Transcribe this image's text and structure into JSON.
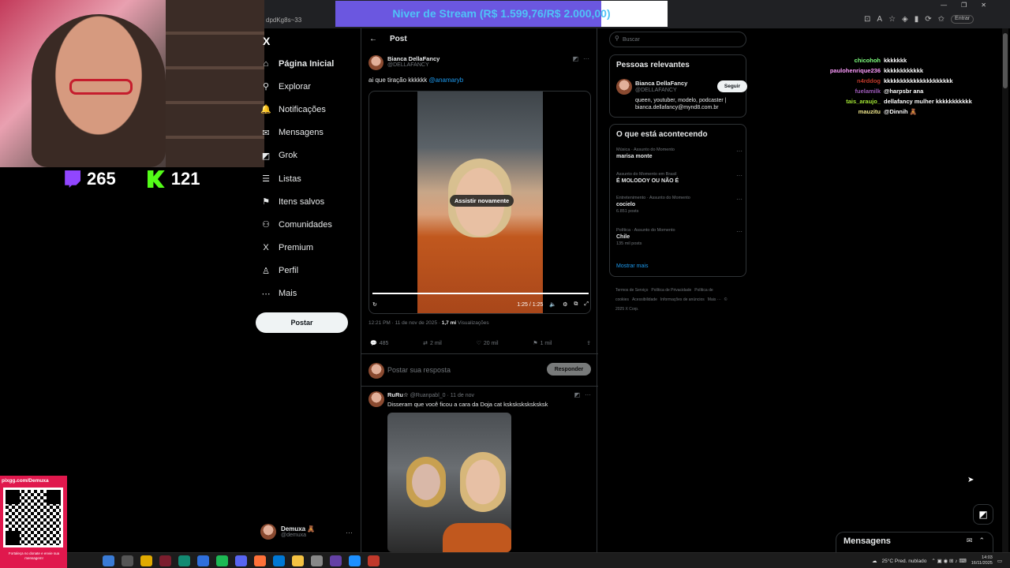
{
  "stream": {
    "goal_text": "Niver de Stream (R$ 1.599,76/R$ 2.000,00)",
    "goal_progress": 0.7999,
    "twitch_viewers": "265",
    "kick_viewers": "121",
    "pix_url": "pixgg.com/Demuxa",
    "pix_note": "Fortaleça no donate e envie sua mensagem!"
  },
  "browser": {
    "url_fragment": "dpdKg8s~33",
    "profile_label": "Entrar"
  },
  "nav": {
    "items": [
      {
        "label": "Página Inicial",
        "icon": "home-icon",
        "glyph": "⌂"
      },
      {
        "label": "Explorar",
        "icon": "search-icon",
        "glyph": "⚲"
      },
      {
        "label": "Notificações",
        "icon": "bell-icon",
        "glyph": "🔔"
      },
      {
        "label": "Mensagens",
        "icon": "mail-icon",
        "glyph": "✉"
      },
      {
        "label": "Grok",
        "icon": "grok-icon",
        "glyph": "◩"
      },
      {
        "label": "Listas",
        "icon": "list-icon",
        "glyph": "☰"
      },
      {
        "label": "Itens salvos",
        "icon": "bookmark-icon",
        "glyph": "⚑"
      },
      {
        "label": "Comunidades",
        "icon": "people-icon",
        "glyph": "⚇"
      },
      {
        "label": "Premium",
        "icon": "x-logo-icon",
        "glyph": "X"
      },
      {
        "label": "Perfil",
        "icon": "person-icon",
        "glyph": "♙"
      },
      {
        "label": "Mais",
        "icon": "more-circle-icon",
        "glyph": "⋯"
      }
    ],
    "post_button": "Postar",
    "account_name": "Demuxa 🧸",
    "account_handle": "@demuxa"
  },
  "post": {
    "header_title": "Post",
    "author_name": "Bianca DellaFancy",
    "author_handle": "@DELLAFANCY",
    "text": "ai que tiração kkkkkk",
    "mention": "@anamaryb",
    "video_overlay": "Assistir novamente",
    "video_time": "1:25 / 1:25",
    "video_progress": 1.0,
    "timestamp": "12:21 PM · 11 de nov de 2025 ·",
    "views_count": "1,7 mi",
    "views_label": "Visualizações",
    "replies": "485",
    "reposts": "2 mil",
    "likes": "20 mil",
    "bookmarks": "1 mil"
  },
  "reply_box": {
    "placeholder": "Postar sua resposta",
    "button": "Responder"
  },
  "reply1": {
    "name": "RuRu☆",
    "handle": "@Ruanpabl_0 · 11 de nov",
    "text": "Disseram que você ficou a cara da Doja cat ksksksksksksksk"
  },
  "search": {
    "placeholder": "Buscar"
  },
  "relevant": {
    "title": "Pessoas relevantes",
    "name": "Bianca DellaFancy",
    "handle": "@DELLAFANCY",
    "bio": "queen, youtuber, modelo, podcaster | bianca.dellafancy@mynd8.com.br",
    "follow": "Seguir"
  },
  "trends": {
    "title": "O que está acontecendo",
    "items": [
      {
        "category": "Música · Assunto do Momento",
        "topic": "marisa monte",
        "count": ""
      },
      {
        "category": "Assunto do Momento em Brasil",
        "topic": "É MOLODOY OU NÃO É",
        "count": ""
      },
      {
        "category": "Entretenimento · Assunto do Momento",
        "topic": "cocielo",
        "count": "6.851 posts"
      },
      {
        "category": "Política · Assunto do Momento",
        "topic": "Chile",
        "count": "135 mil posts"
      }
    ],
    "show_more": "Mostrar mais"
  },
  "footer_links": [
    "Termos de Serviço",
    "Política de Privacidade",
    "Política de cookies",
    "Acessibilidade",
    "Informações de anúncios",
    "Mais ···",
    "© 2025 X Corp."
  ],
  "chat": [
    {
      "user": "chicohoh",
      "color": "#7fff7f",
      "msg": "kkkkkkk"
    },
    {
      "user": "paulohenrique236",
      "color": "#ff9cff",
      "msg": "kkkkkkkkkkkk"
    },
    {
      "user": "n4rddog",
      "color": "#c0392b",
      "msg": "kkkkkkkkkkkkkkkkkkkkk"
    },
    {
      "user": "fuelamilk",
      "color": "#9b59b6",
      "msg": "@harpsbr ana"
    },
    {
      "user": "tais_araujo_",
      "color": "#a3e635",
      "msg": "dellafancy mulher kkkkkkkkkkk"
    },
    {
      "user": "mauzitu",
      "color": "#f0e68c",
      "msg": "@Dinnih 🧸"
    }
  ],
  "messages_dock": {
    "title": "Mensagens"
  },
  "taskbar": {
    "weather": "25°C  Pred. nublado",
    "time": "14:03",
    "date": "16/11/2025"
  }
}
